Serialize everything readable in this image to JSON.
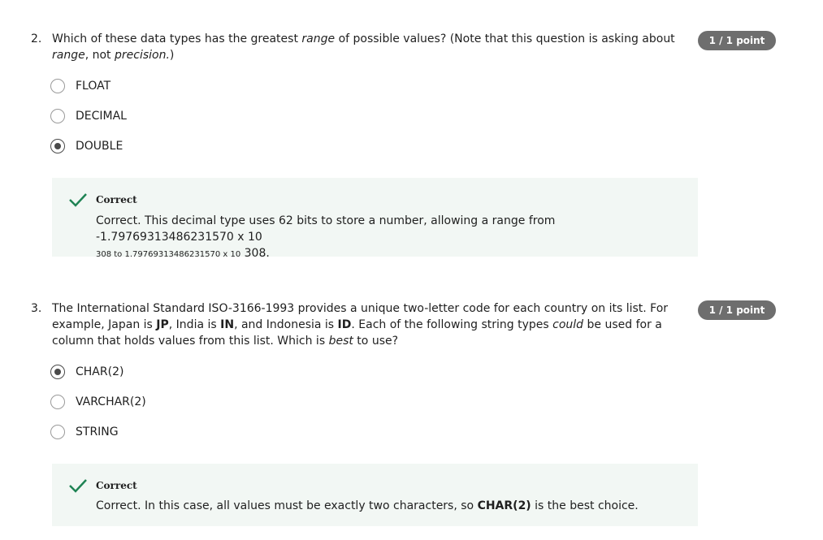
{
  "questions": [
    {
      "number": "2.",
      "text_parts": [
        "Which of these data types has the greatest ",
        "range",
        " of possible values? (Note that this question is asking about ",
        "range",
        ", not ",
        "precision.",
        ")"
      ],
      "points": "1 / 1 point",
      "options": [
        {
          "label": "FLOAT",
          "selected": false
        },
        {
          "label": "DECIMAL",
          "selected": false
        },
        {
          "label": "DOUBLE",
          "selected": true
        }
      ],
      "feedback": {
        "title": "Correct",
        "line1": "Correct. This decimal type uses 62 bits to store a number, allowing a range from -1.79769313486231570 x 10",
        "line2_small": "308 to 1.79769313486231570 x 10",
        "line2_end": " 308."
      }
    },
    {
      "number": "3.",
      "text_parts": [
        "The International Standard ISO-3166-1993 provides a unique two-letter code for each country on its list. For example, Japan is ",
        "JP",
        ", India is ",
        "IN",
        ", and Indonesia is ",
        "ID",
        ". Each of the following string types ",
        "could",
        " be used for a column that holds values from this list. Which is ",
        "best",
        " to use?"
      ],
      "points": "1 / 1 point",
      "options": [
        {
          "label": "CHAR(2)",
          "selected": true
        },
        {
          "label": "VARCHAR(2)",
          "selected": false
        },
        {
          "label": "STRING",
          "selected": false
        }
      ],
      "feedback": {
        "title": "Correct",
        "text_before": "Correct. In this case, all values must be exactly two characters, so ",
        "text_bold": "CHAR(2)",
        "text_after": " is the best choice."
      }
    }
  ],
  "colors": {
    "badge": "#6e6e6e",
    "feedback_bg": "#f2f7f4",
    "check": "#1f8354"
  },
  "icons": {
    "check": "checkmark-icon"
  }
}
